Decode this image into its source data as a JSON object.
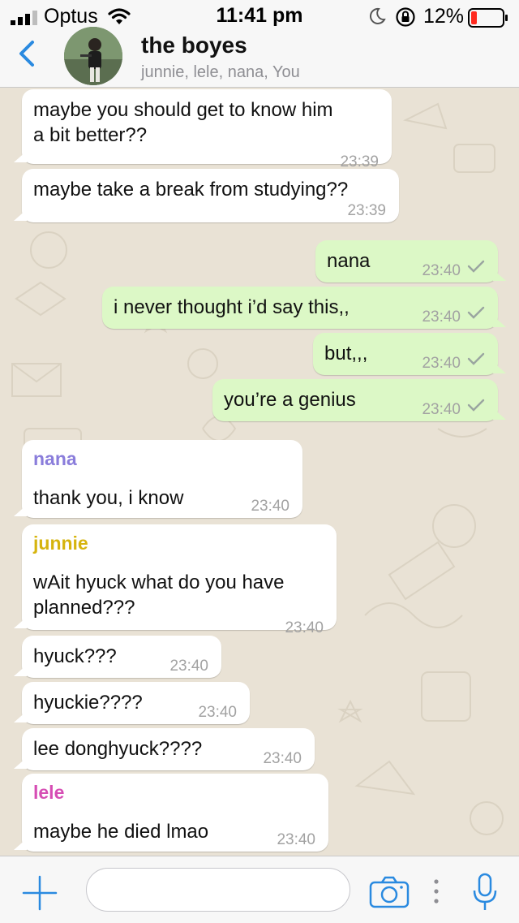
{
  "status_bar": {
    "carrier": "Optus",
    "time": "11:41 pm",
    "battery_percent": "12%",
    "icons": [
      "signal-icon",
      "wifi-icon",
      "moon-icon",
      "orientation-lock-icon",
      "battery-icon"
    ]
  },
  "header": {
    "title": "the boyes",
    "members": "junnie, lele, nana, You",
    "back_icon": "chevron-left-icon"
  },
  "messages": [
    {
      "dir": "in",
      "text_lines": [
        "maybe you should get to know him",
        "a bit better??"
      ],
      "time": "23:39"
    },
    {
      "dir": "in",
      "text_lines": [
        "maybe take a break from studying??"
      ],
      "time": "23:39"
    },
    {
      "dir": "out",
      "text_lines": [
        "nana"
      ],
      "time": "23:40",
      "status": "sent"
    },
    {
      "dir": "out",
      "text_lines": [
        "i never thought i’d say this,,"
      ],
      "time": "23:40",
      "status": "sent"
    },
    {
      "dir": "out",
      "text_lines": [
        "but,,,"
      ],
      "time": "23:40",
      "status": "sent"
    },
    {
      "dir": "out",
      "text_lines": [
        "you’re a genius"
      ],
      "time": "23:40",
      "status": "sent"
    },
    {
      "dir": "in",
      "sender": "nana",
      "text_lines": [
        "thank you, i know"
      ],
      "time": "23:40"
    },
    {
      "dir": "in",
      "sender": "junnie",
      "text_lines": [
        "wAit hyuck what do you have",
        "planned???"
      ],
      "time": "23:40"
    },
    {
      "dir": "in",
      "text_lines": [
        "hyuck???"
      ],
      "time": "23:40"
    },
    {
      "dir": "in",
      "text_lines": [
        "hyuckie????"
      ],
      "time": "23:40"
    },
    {
      "dir": "in",
      "text_lines": [
        "lee donghyuck????"
      ],
      "time": "23:40"
    },
    {
      "dir": "in",
      "sender": "lele",
      "text_lines": [
        "maybe he died lmao"
      ],
      "time": "23:40"
    }
  ],
  "sender_colors": {
    "nana": "#8a7ddb",
    "junnie": "#d6b40e",
    "lele": "#d64db4"
  },
  "colors": {
    "accent": "#2a8ae0",
    "outgoing_bubble": "#dcf8c6",
    "incoming_bubble": "#ffffff",
    "read_check": "#9aa5a0"
  },
  "input_bar": {
    "placeholder": "",
    "icons": [
      "plus-icon",
      "camera-icon",
      "more-dots-icon",
      "microphone-icon"
    ]
  }
}
